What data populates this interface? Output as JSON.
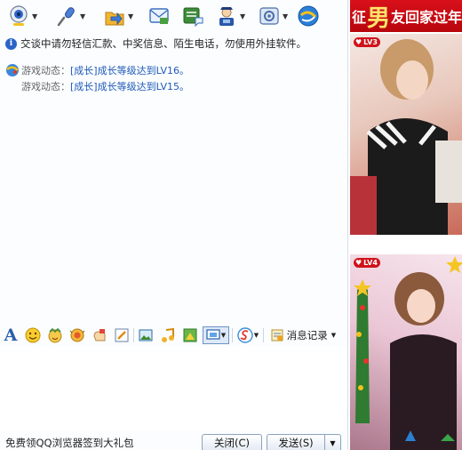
{
  "toolbar": {
    "items": [
      {
        "icon": "video-call-icon",
        "has_dropdown": true
      },
      {
        "icon": "voice-call-icon",
        "has_dropdown": true
      },
      {
        "icon": "send-file-icon",
        "has_dropdown": true
      },
      {
        "icon": "send-sms-icon",
        "has_dropdown": false
      },
      {
        "icon": "create-group-icon",
        "has_dropdown": false
      },
      {
        "icon": "remote-assist-icon",
        "has_dropdown": true
      },
      {
        "icon": "app-center-icon",
        "has_dropdown": true
      },
      {
        "icon": "qq-game-icon",
        "has_dropdown": false
      }
    ]
  },
  "safety_notice": "交谈中请勿轻信汇款、中奖信息、陌生电话，勿使用外挂软件。",
  "game_updates": [
    {
      "label": "游戏动态：",
      "link": "[成长]成长等级达到LV16。"
    },
    {
      "label": "游戏动态：",
      "link": "[成长]成长等级达到LV15。"
    }
  ],
  "format_bar": {
    "font_glyph": "A",
    "history_label": "消息记录"
  },
  "bottom": {
    "promo": "免费领QQ浏览器签到大礼包",
    "close_label": "关闭(C)",
    "send_label": "发送(S)"
  },
  "ad": {
    "banner_prefix": "征",
    "banner_big": "男",
    "banner_suffix": "友回家过年",
    "level1": "LV3",
    "level2": "LV4"
  },
  "colors": {
    "accent_blue": "#2a5fa8",
    "link_blue": "#1f5ab8",
    "banner_red": "#d0131b"
  }
}
